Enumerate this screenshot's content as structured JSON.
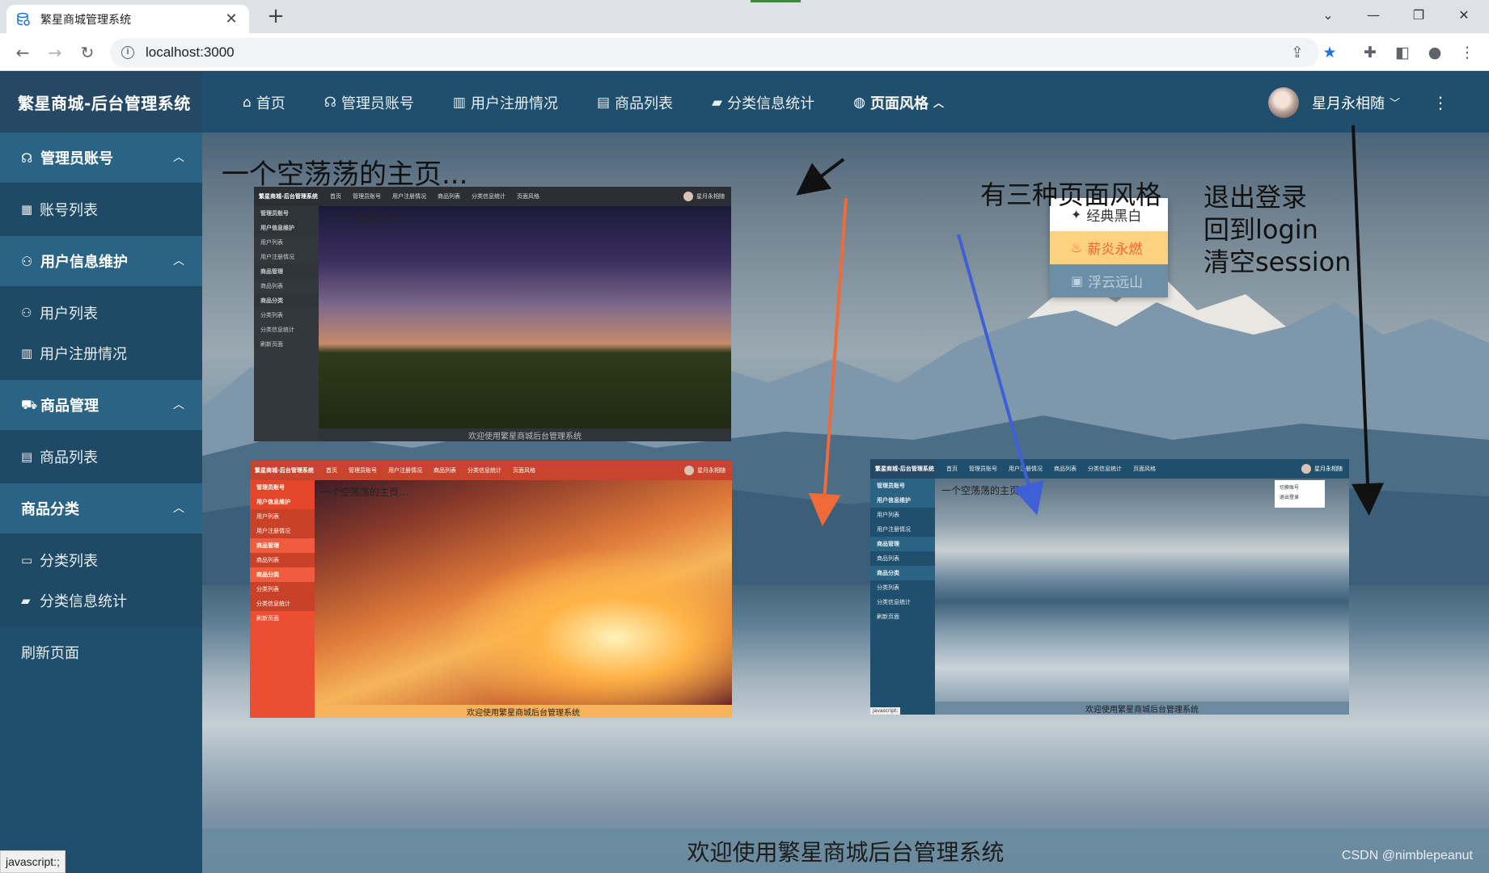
{
  "browser": {
    "tab_title": "繁星商城管理系统",
    "tab_close": "✕",
    "new_tab": "+",
    "url": "localhost:3000",
    "status_text": "javascript:;"
  },
  "sidebar": {
    "logo": "繁星商城-后台管理系统",
    "groups": [
      {
        "title": "管理员账号",
        "icon": "headset-icon",
        "items": [
          {
            "label": "账号列表",
            "icon": "table-icon"
          }
        ]
      },
      {
        "title": "用户信息维护",
        "icon": "user-icon",
        "items": [
          {
            "label": "用户列表",
            "icon": "user-icon"
          },
          {
            "label": "用户注册情况",
            "icon": "grid-icon"
          }
        ]
      },
      {
        "title": "商品管理",
        "icon": "cart-icon",
        "items": [
          {
            "label": "商品列表",
            "icon": "clipboard-icon"
          }
        ]
      },
      {
        "title": "商品分类",
        "icon": "",
        "items": [
          {
            "label": "分类列表",
            "icon": "document-icon"
          },
          {
            "label": "分类信息统计",
            "icon": "chat-icon"
          }
        ]
      }
    ],
    "refresh": "刷新页面"
  },
  "topbar": {
    "items": [
      {
        "label": "首页",
        "icon": "home-icon"
      },
      {
        "label": "管理员账号",
        "icon": "headset-icon"
      },
      {
        "label": "用户注册情况",
        "icon": "grid-icon"
      },
      {
        "label": "商品列表",
        "icon": "clipboard-icon"
      },
      {
        "label": "分类信息统计",
        "icon": "chat-icon"
      },
      {
        "label": "页面风格",
        "icon": "palette-icon"
      }
    ],
    "username": "星月永相随"
  },
  "main": {
    "title": "一个空荡荡的主页...",
    "footer": "欢迎使用繁星商城后台管理系统"
  },
  "style_dropdown": {
    "options": [
      {
        "label": "经典黑白",
        "icon": "magic-wand-icon"
      },
      {
        "label": "薪炎永燃",
        "icon": "flame-icon"
      },
      {
        "label": "浮云远山",
        "icon": "picture-icon"
      }
    ]
  },
  "annotations": {
    "three_styles": "有三种页面风格",
    "logout_lines": [
      "退出登录",
      "回到login",
      "清空session"
    ]
  },
  "thumbnails": {
    "logo": "繁星商城-后台管理系统",
    "nav": [
      "首页",
      "管理员账号",
      "用户注册情况",
      "商品列表",
      "分类信息统计",
      "页面风格"
    ],
    "user": "星月永相随",
    "heading": "一个空荡荡的主页...",
    "footer": "欢迎使用繁星商城后台管理系统",
    "menu": [
      "管理员账号",
      "用户信息维护",
      "用户列表",
      "用户注册情况",
      "商品管理",
      "商品列表",
      "商品分类",
      "分类列表",
      "分类信息统计",
      "刷新页面"
    ],
    "user_menu": [
      "切换账号",
      "退出登录"
    ],
    "status": "javascript:"
  },
  "watermark": "CSDN @nimblepeanut",
  "colors": {
    "sidebar": "#1f4f6c",
    "classic_dark": "#2b2f33",
    "fire": "#e9533a",
    "cloud": "#1f4f6c"
  }
}
